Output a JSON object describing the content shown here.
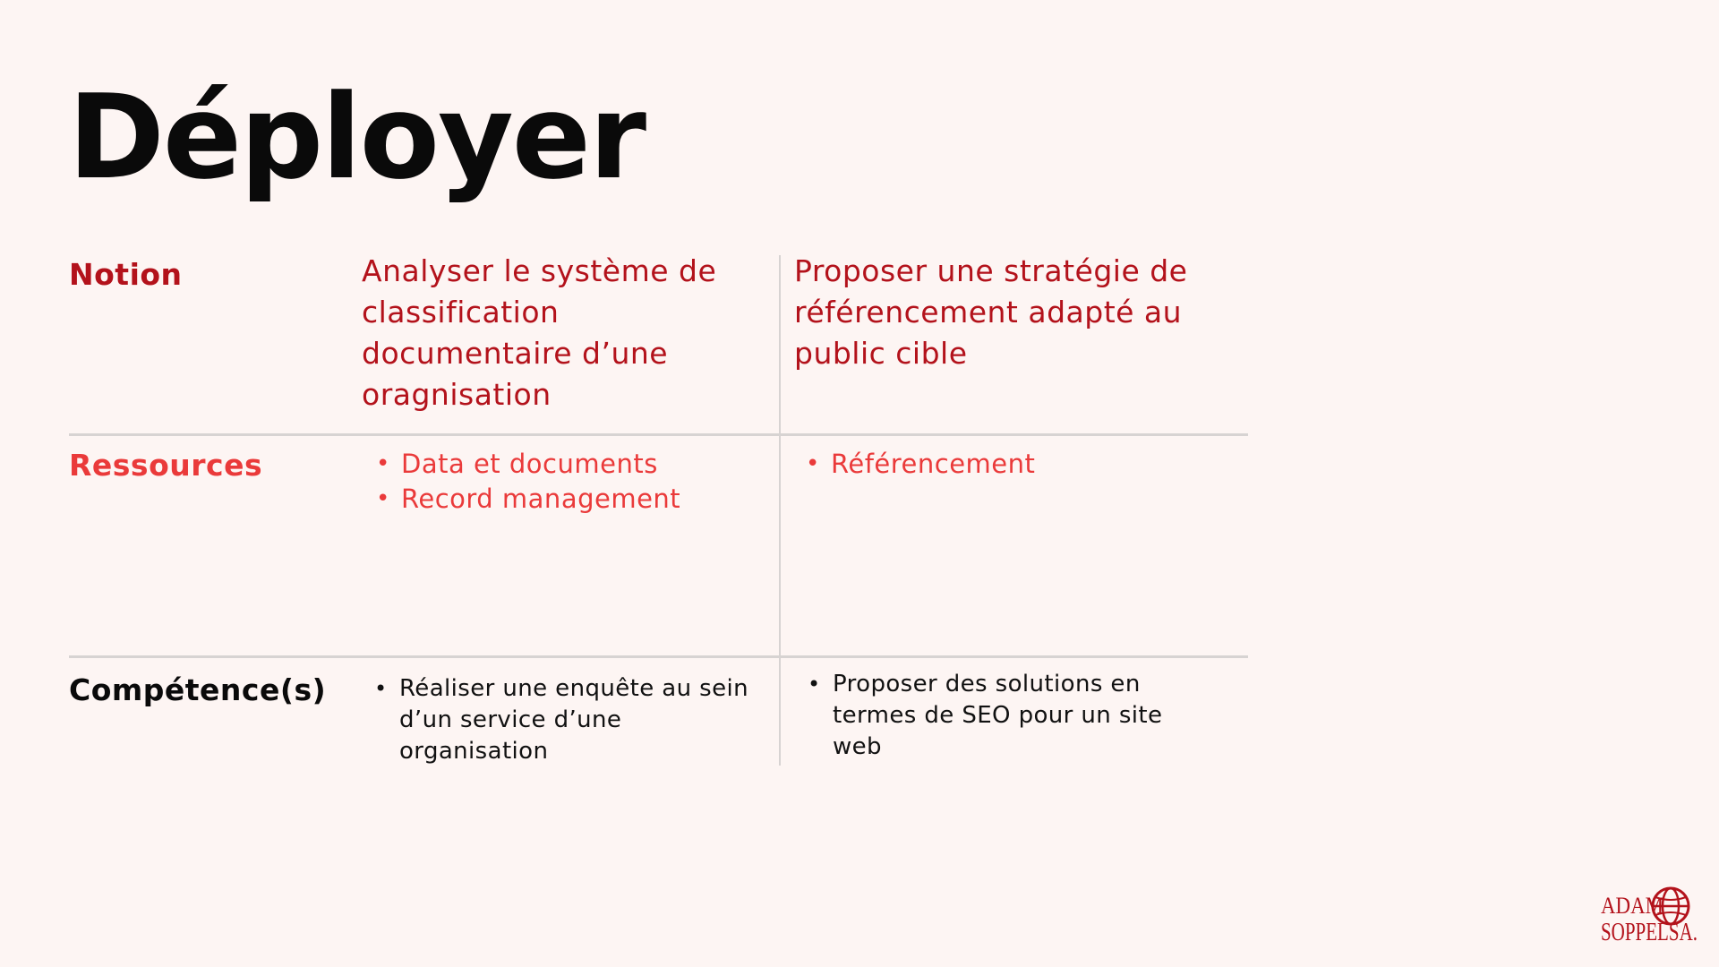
{
  "title": "Déployer",
  "rows": {
    "notion": {
      "label": "Notion",
      "col1": "Analyser le système de classification documentaire d’une oragnisation",
      "col2": "Proposer une stratégie de référencement adapté au public cible"
    },
    "ressources": {
      "label": "Ressources",
      "col1": [
        "Data et documents",
        "Record management"
      ],
      "col2": [
        "Référencement"
      ]
    },
    "competences": {
      "label": "Compétence(s)",
      "col1": [
        "Réaliser une enquête au sein d’un service d’une organisation"
      ],
      "col2": [
        "Proposer des solutions en termes de SEO pour un site web"
      ]
    }
  },
  "logo": {
    "line1": "ADAM",
    "line2": "SOPPELSA."
  },
  "colors": {
    "background": "#fdf5f3",
    "dark_red": "#b3121b",
    "light_red": "#ea3a3a",
    "text": "#0a0a0a",
    "divider": "#d7d3d2"
  }
}
